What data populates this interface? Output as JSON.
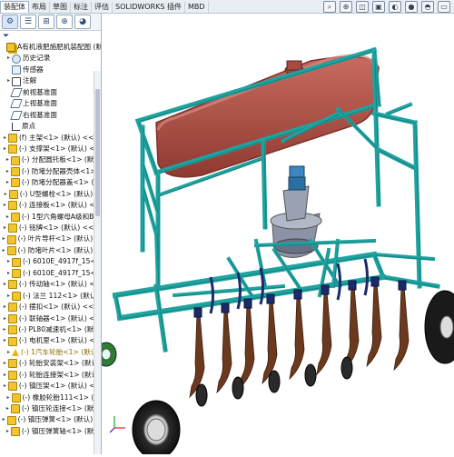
{
  "menu_tabs": [
    "装配体",
    "布局",
    "草图",
    "标注",
    "评估",
    "SOLIDWORKS 插件",
    "MBD"
  ],
  "active_tab_index": 0,
  "headsup_icons": [
    "search-icon",
    "zoom-icon",
    "view-icon",
    "display-icon",
    "hide-icon",
    "appearance-icon",
    "scene-icon",
    "monitor-icon"
  ],
  "panel_tabs": [
    "feature-manager-icon",
    "property-manager-icon",
    "configuration-manager-icon",
    "dimxpert-icon",
    "display-manager-icon"
  ],
  "tree": [
    {
      "type": "asm",
      "label": "A有机液肥施肥机装配图 (默",
      "level": 0,
      "arrow": ""
    },
    {
      "type": "hist",
      "label": "历史记录",
      "level": 1,
      "arrow": "▸"
    },
    {
      "type": "sens",
      "label": "传感器",
      "level": 1,
      "arrow": ""
    },
    {
      "type": "note",
      "label": "注解",
      "level": 1,
      "arrow": "▸"
    },
    {
      "type": "plane",
      "label": "前视基准面",
      "level": 1,
      "arrow": ""
    },
    {
      "type": "plane",
      "label": "上视基准面",
      "level": 1,
      "arrow": ""
    },
    {
      "type": "plane",
      "label": "右视基准面",
      "level": 1,
      "arrow": ""
    },
    {
      "type": "origin",
      "label": "原点",
      "level": 1,
      "arrow": ""
    },
    {
      "type": "part",
      "label": "(f) 主架<1> (默认) <<默",
      "level": 1,
      "arrow": "▸"
    },
    {
      "type": "part",
      "label": "(-) 支撑架<1> (默认) <<",
      "level": 1,
      "arrow": "▸"
    },
    {
      "type": "part",
      "label": "(-) 分配圆托板<1> (默认",
      "level": 1,
      "arrow": "▸"
    },
    {
      "type": "part",
      "label": "(-) 防堵分配器壳体<1> (",
      "level": 1,
      "arrow": "▸"
    },
    {
      "type": "part",
      "label": "(-) 防堵分配器盖<1> (默",
      "level": 1,
      "arrow": "▸"
    },
    {
      "type": "part",
      "label": "(-) U型螺栓<1> (默认) <",
      "level": 1,
      "arrow": "▸"
    },
    {
      "type": "part",
      "label": "(-) 连接板<1> (默认) <<",
      "level": 1,
      "arrow": "▸"
    },
    {
      "type": "part",
      "label": "(-) 1型六角螺母A级和B级",
      "level": 1,
      "arrow": "▸"
    },
    {
      "type": "part",
      "label": "(-) 铭牌<1> (默认) <<默",
      "level": 1,
      "arrow": "▸"
    },
    {
      "type": "part",
      "label": "(-) 叶片导杆<1> (默认) <",
      "level": 1,
      "arrow": "▸"
    },
    {
      "type": "part",
      "label": "(-) 防堵叶片<1> (默认) <",
      "level": 1,
      "arrow": "▸"
    },
    {
      "type": "part",
      "label": "(-) 6010E_4917f_15<1",
      "level": 1,
      "arrow": "▸"
    },
    {
      "type": "part",
      "label": "(-) 6010E_4917f_15<2",
      "level": 1,
      "arrow": "▸"
    },
    {
      "type": "part",
      "label": "(-) 传动轴<1> (默认) <<",
      "level": 1,
      "arrow": "▸"
    },
    {
      "type": "part",
      "label": "(-) 法兰 112<1> (默认)",
      "level": 1,
      "arrow": "▸"
    },
    {
      "type": "part",
      "label": "(-) 摆扣<1> (默认) <<默",
      "level": 1,
      "arrow": "▸"
    },
    {
      "type": "part",
      "label": "(-) 联轴器<1> (默认) <<",
      "level": 1,
      "arrow": "▸"
    },
    {
      "type": "part",
      "label": "(-) PL80减速机<1> (默认",
      "level": 1,
      "arrow": "▸"
    },
    {
      "type": "part",
      "label": "(-) 电机里<1> (默认) <<",
      "level": 1,
      "arrow": "▸"
    },
    {
      "type": "warn",
      "label": "(-) 1汽车轮胎<1> (默认",
      "level": 1,
      "arrow": "▸"
    },
    {
      "type": "part",
      "label": "(-) 轮胎安装架<1> (默认)",
      "level": 1,
      "arrow": "▸"
    },
    {
      "type": "part",
      "label": "(-) 轮胎连接架<1> (默认)",
      "level": 1,
      "arrow": "▸"
    },
    {
      "type": "part",
      "label": "(-) 镇压架<1> (默认) <<",
      "level": 1,
      "arrow": "▸"
    },
    {
      "type": "part",
      "label": "(-) 橡胶轮胎111<1> (默",
      "level": 1,
      "arrow": "▸"
    },
    {
      "type": "part",
      "label": "(-) 镇压轮连接<1> (默认",
      "level": 1,
      "arrow": "▸"
    },
    {
      "type": "part",
      "label": "(-) 镇压弹簧<1> (默认) <",
      "level": 1,
      "arrow": "▸"
    },
    {
      "type": "part",
      "label": "(-) 镇压弹簧轴<1> (默认",
      "level": 1,
      "arrow": "▸"
    }
  ],
  "colors": {
    "frame": "#1fa3a0",
    "frame_dark": "#0f6e6c",
    "tank": "#b24f45",
    "tank_dark": "#7d3129",
    "tine": "#6b3a1e",
    "hopper": "#8c93a6",
    "wheel": "#1c1c1c",
    "hub": "#dcdcdc",
    "accent": "#e8b710"
  }
}
